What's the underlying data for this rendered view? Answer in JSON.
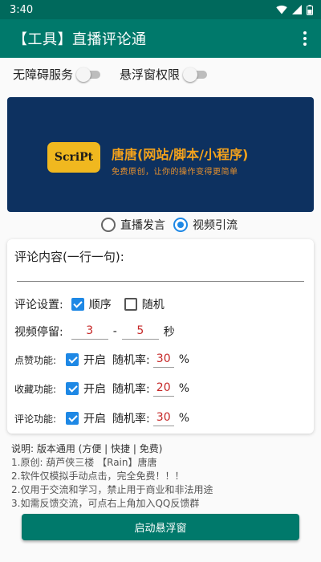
{
  "status": {
    "time": "3:40"
  },
  "app": {
    "title": "【工具】直播评论通"
  },
  "permissions": {
    "accessibility_label": "无障碍服务",
    "floating_label": "悬浮窗权限"
  },
  "banner": {
    "logo_text": "ScriPt",
    "title": "唐唐(网站/脚本/小程序)",
    "subtitle": "免费原创，让你的操作变得更简单"
  },
  "mode": {
    "options": [
      "直播发言",
      "视频引流"
    ],
    "selected": "视频引流"
  },
  "form": {
    "comment_label": "评论内容(一行一句):",
    "comment_value": "",
    "settings_label": "评论设置:",
    "order_label": "顺序",
    "order_checked": true,
    "random_label": "随机",
    "random_checked": false,
    "stay_label": "视频停留:",
    "stay_min": "3",
    "stay_dash": "-",
    "stay_max": "5",
    "stay_unit": "秒",
    "enable_label": "开启",
    "rate_label": "随机率:",
    "percent": "%",
    "features": [
      {
        "label": "点赞功能:",
        "enabled": true,
        "rate": "30"
      },
      {
        "label": "收藏功能:",
        "enabled": true,
        "rate": "20"
      },
      {
        "label": "评论功能:",
        "enabled": true,
        "rate": "30"
      }
    ]
  },
  "notes": {
    "heading": "说明: 版本通用 (方便 | 快捷 | 免费)",
    "lines": [
      "1.原创: 葫芦侠三楼 【Rain】唐唐",
      "2.软件仅模拟手动点击，完全免费！！！",
      "2.仅用于交流和学习，禁止用于商业和非法用途",
      "3.如需反馈交流，可点右上角加入QQ反馈群"
    ]
  },
  "start_button_label": "启动悬浮窗",
  "colors": {
    "primary": "#00796b",
    "primary_dark": "#00695c",
    "accent": "#1e88e5",
    "banner_bg": "#0d3160",
    "logo_bg": "#f0b81f",
    "banner_text": "#f4a21b"
  }
}
